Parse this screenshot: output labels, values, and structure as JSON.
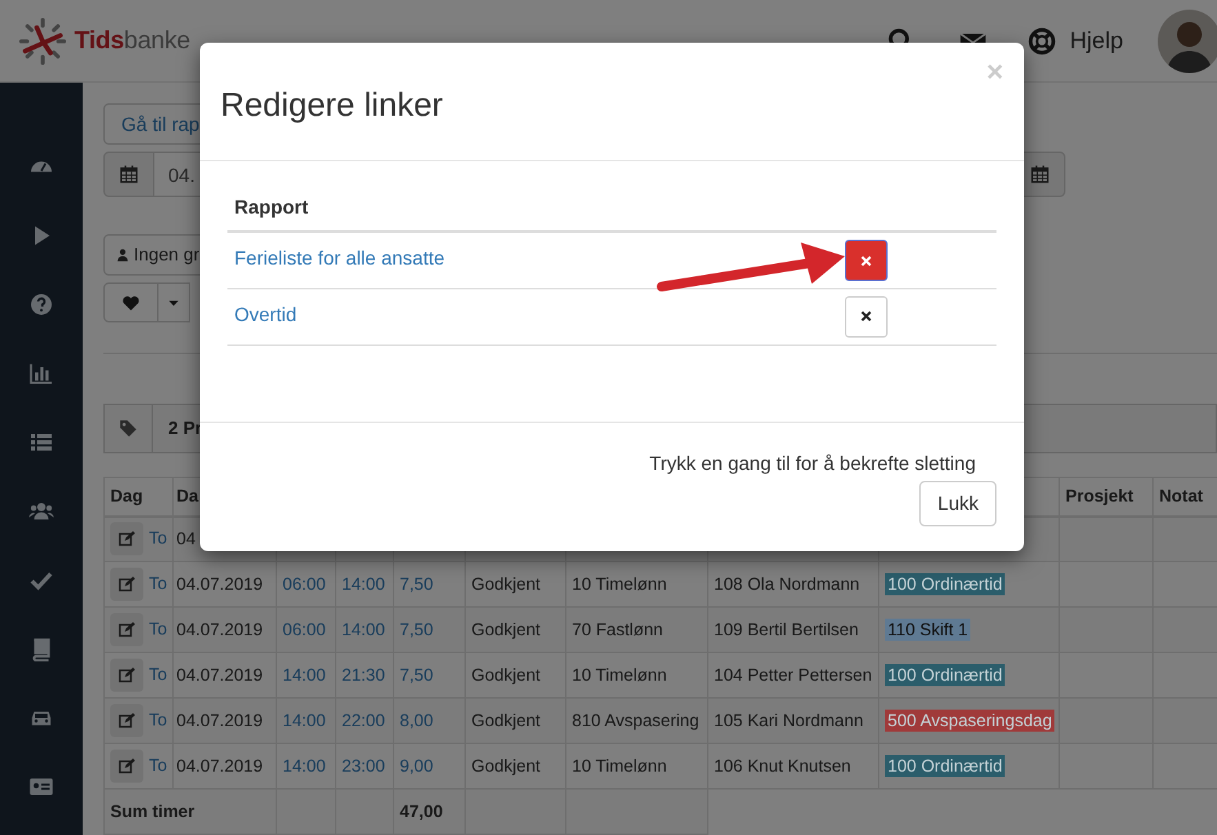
{
  "header": {
    "brand_strong": "Tids",
    "brand_rest": "banke",
    "help": "Hjelp"
  },
  "toolbar": {
    "report_button": "Gå til rap",
    "date_value": "04.",
    "group_button": "Ingen gr",
    "tag_summary": "2 Pr"
  },
  "table": {
    "header": {
      "column_1": "Dag",
      "column_2": "Da",
      "column_10": "Prosjekt",
      "column_11": "Notat"
    },
    "rows": [
      {
        "day": "To",
        "date": "04"
      },
      {
        "day": "To",
        "date": "04.07.2019",
        "from": "06:00",
        "to": "14:00",
        "hours": "7,50",
        "status": "Godkjent",
        "wage_type": "10 Timelønn",
        "employee": "108 Ola Nordmann",
        "activity": {
          "text": "100 Ordinærtid",
          "color": "#2b5d6b"
        }
      },
      {
        "day": "To",
        "date": "04.07.2019",
        "from": "06:00",
        "to": "14:00",
        "hours": "7,50",
        "status": "Godkjent",
        "wage_type": "70 Fastlønn",
        "employee": "109 Bertil Bertilsen",
        "activity": {
          "text": "110 Skift 1",
          "color": "#5f7a93"
        }
      },
      {
        "day": "To",
        "date": "04.07.2019",
        "from": "14:00",
        "to": "21:30",
        "hours": "7,50",
        "status": "Godkjent",
        "wage_type": "10 Timelønn",
        "employee": "104 Petter Pettersen",
        "activity": {
          "text": "100 Ordinærtid",
          "color": "#2b5d6b"
        }
      },
      {
        "day": "To",
        "date": "04.07.2019",
        "from": "14:00",
        "to": "22:00",
        "hours": "8,00",
        "status": "Godkjent",
        "wage_type": "810 Avspasering",
        "employee": "105 Kari Nordmann",
        "activity": {
          "text": "500 Avspaseringsdag",
          "color": "#a03a3a"
        }
      },
      {
        "day": "To",
        "date": "04.07.2019",
        "from": "14:00",
        "to": "23:00",
        "hours": "9,00",
        "status": "Godkjent",
        "wage_type": "10 Timelønn",
        "employee": "106 Knut Knutsen",
        "activity": {
          "text": "100 Ordinærtid",
          "color": "#2b5d6b"
        }
      }
    ],
    "footer": {
      "label": "Sum timer",
      "total": "47,00"
    }
  },
  "modal": {
    "title": "Redigere linker",
    "close": "×",
    "column": "Rapport",
    "links": [
      {
        "label": "Ferieliste for alle ansatte",
        "pending_delete": true
      },
      {
        "label": "Overtid",
        "pending_delete": false
      }
    ],
    "confirm_hint": "Trykk en gang til for å bekrefte sletting",
    "close_button": "Lukk"
  }
}
